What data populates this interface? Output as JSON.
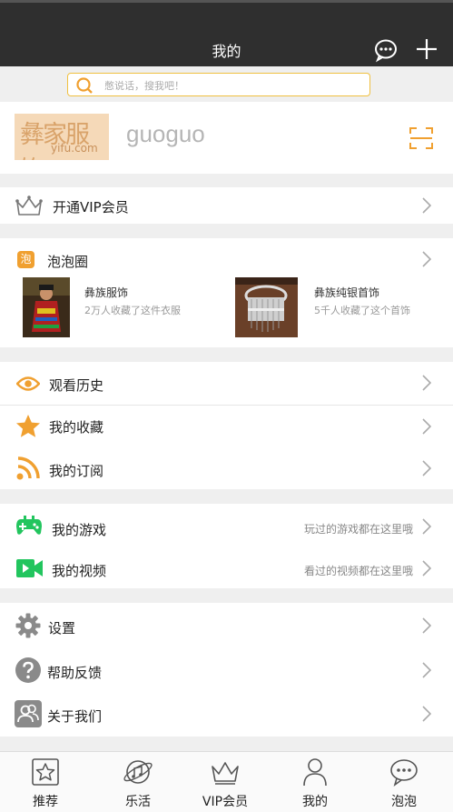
{
  "header": {
    "title": "我的"
  },
  "search": {
    "placeholder": "憋说话，搜我吧！"
  },
  "profile": {
    "logo_text": "彝家服饰",
    "logo_sub": "yifu.com",
    "username": "guoguo"
  },
  "vip": {
    "label": "开通VIP会员"
  },
  "circle": {
    "badge": "泡",
    "label": "泡泡圈",
    "posts": [
      {
        "title": "彝族服饰",
        "subtitle": "2万人收藏了这件衣服"
      },
      {
        "title": "彝族纯银首饰",
        "subtitle": "5千人收藏了这个首饰"
      }
    ]
  },
  "group1": [
    {
      "label": "观看历史",
      "icon": "eye-icon"
    },
    {
      "label": "我的收藏",
      "icon": "star-icon"
    },
    {
      "label": "我的订阅",
      "icon": "rss-icon"
    }
  ],
  "group2": [
    {
      "label": "我的游戏",
      "hint": "玩过的游戏都在这里哦",
      "icon": "gamepad-icon"
    },
    {
      "label": "我的视频",
      "hint": "看过的视频都在这里哦",
      "icon": "video-icon"
    }
  ],
  "group3": [
    {
      "label": "设置",
      "icon": "gear-icon"
    },
    {
      "label": "帮助反馈",
      "icon": "help-icon"
    },
    {
      "label": "关于我们",
      "icon": "people-icon"
    }
  ],
  "tabs": [
    {
      "label": "推荐"
    },
    {
      "label": "乐活"
    },
    {
      "label": "VIP会员"
    },
    {
      "label": "我的"
    },
    {
      "label": "泡泡"
    }
  ],
  "colors": {
    "accent": "#f0a030",
    "green": "#22c55e",
    "gray_icon": "#8a8a8a",
    "topbar": "#2f2f2f"
  }
}
